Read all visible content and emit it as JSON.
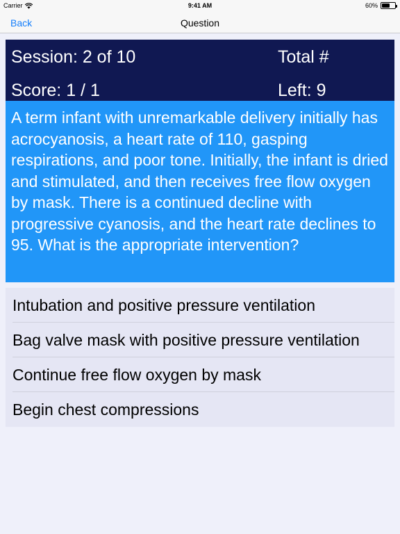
{
  "status_bar": {
    "carrier": "Carrier",
    "time": "9:41 AM",
    "battery": "60%",
    "battery_level": 0.6
  },
  "nav": {
    "back_label": "Back",
    "title": "Question",
    "accent": "#147efb"
  },
  "score_panel": {
    "session": "Session: 2 of 10",
    "total": "Total #",
    "score": "Score: 1 / 1",
    "left": "Left: 9",
    "background": "#101852"
  },
  "question": {
    "text": "A term infant with unremarkable delivery initially has acrocyanosis, a heart rate of 110, gasping respirations, and poor tone. Initially, the infant is dried and stimulated, and then receives free flow oxygen by mask. There is a continued decline with progressive cyanosis, and the heart rate declines to 95. What is the appropriate intervention?",
    "background": "#2196f8"
  },
  "answers": [
    {
      "label": "Intubation and positive pressure ventilation"
    },
    {
      "label": "Bag valve mask with positive pressure ventilation"
    },
    {
      "label": "Continue free flow oxygen by mask"
    },
    {
      "label": "Begin chest compressions"
    }
  ]
}
